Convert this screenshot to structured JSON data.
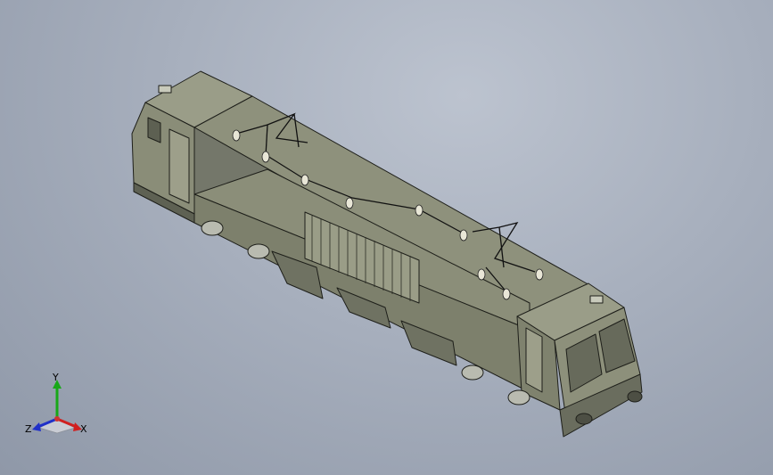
{
  "viewport": {
    "background_top": "#bcc3cf",
    "background_bottom": "#8f98a8"
  },
  "model": {
    "body_color": "#8a8d78",
    "shade_color": "#6c6f5d",
    "edge_color": "#1e1f1a"
  },
  "triad": {
    "x_label": "X",
    "y_label": "Y",
    "z_label": "Z",
    "x_color": "#d02020",
    "y_color": "#18a818",
    "z_color": "#2030c8"
  }
}
